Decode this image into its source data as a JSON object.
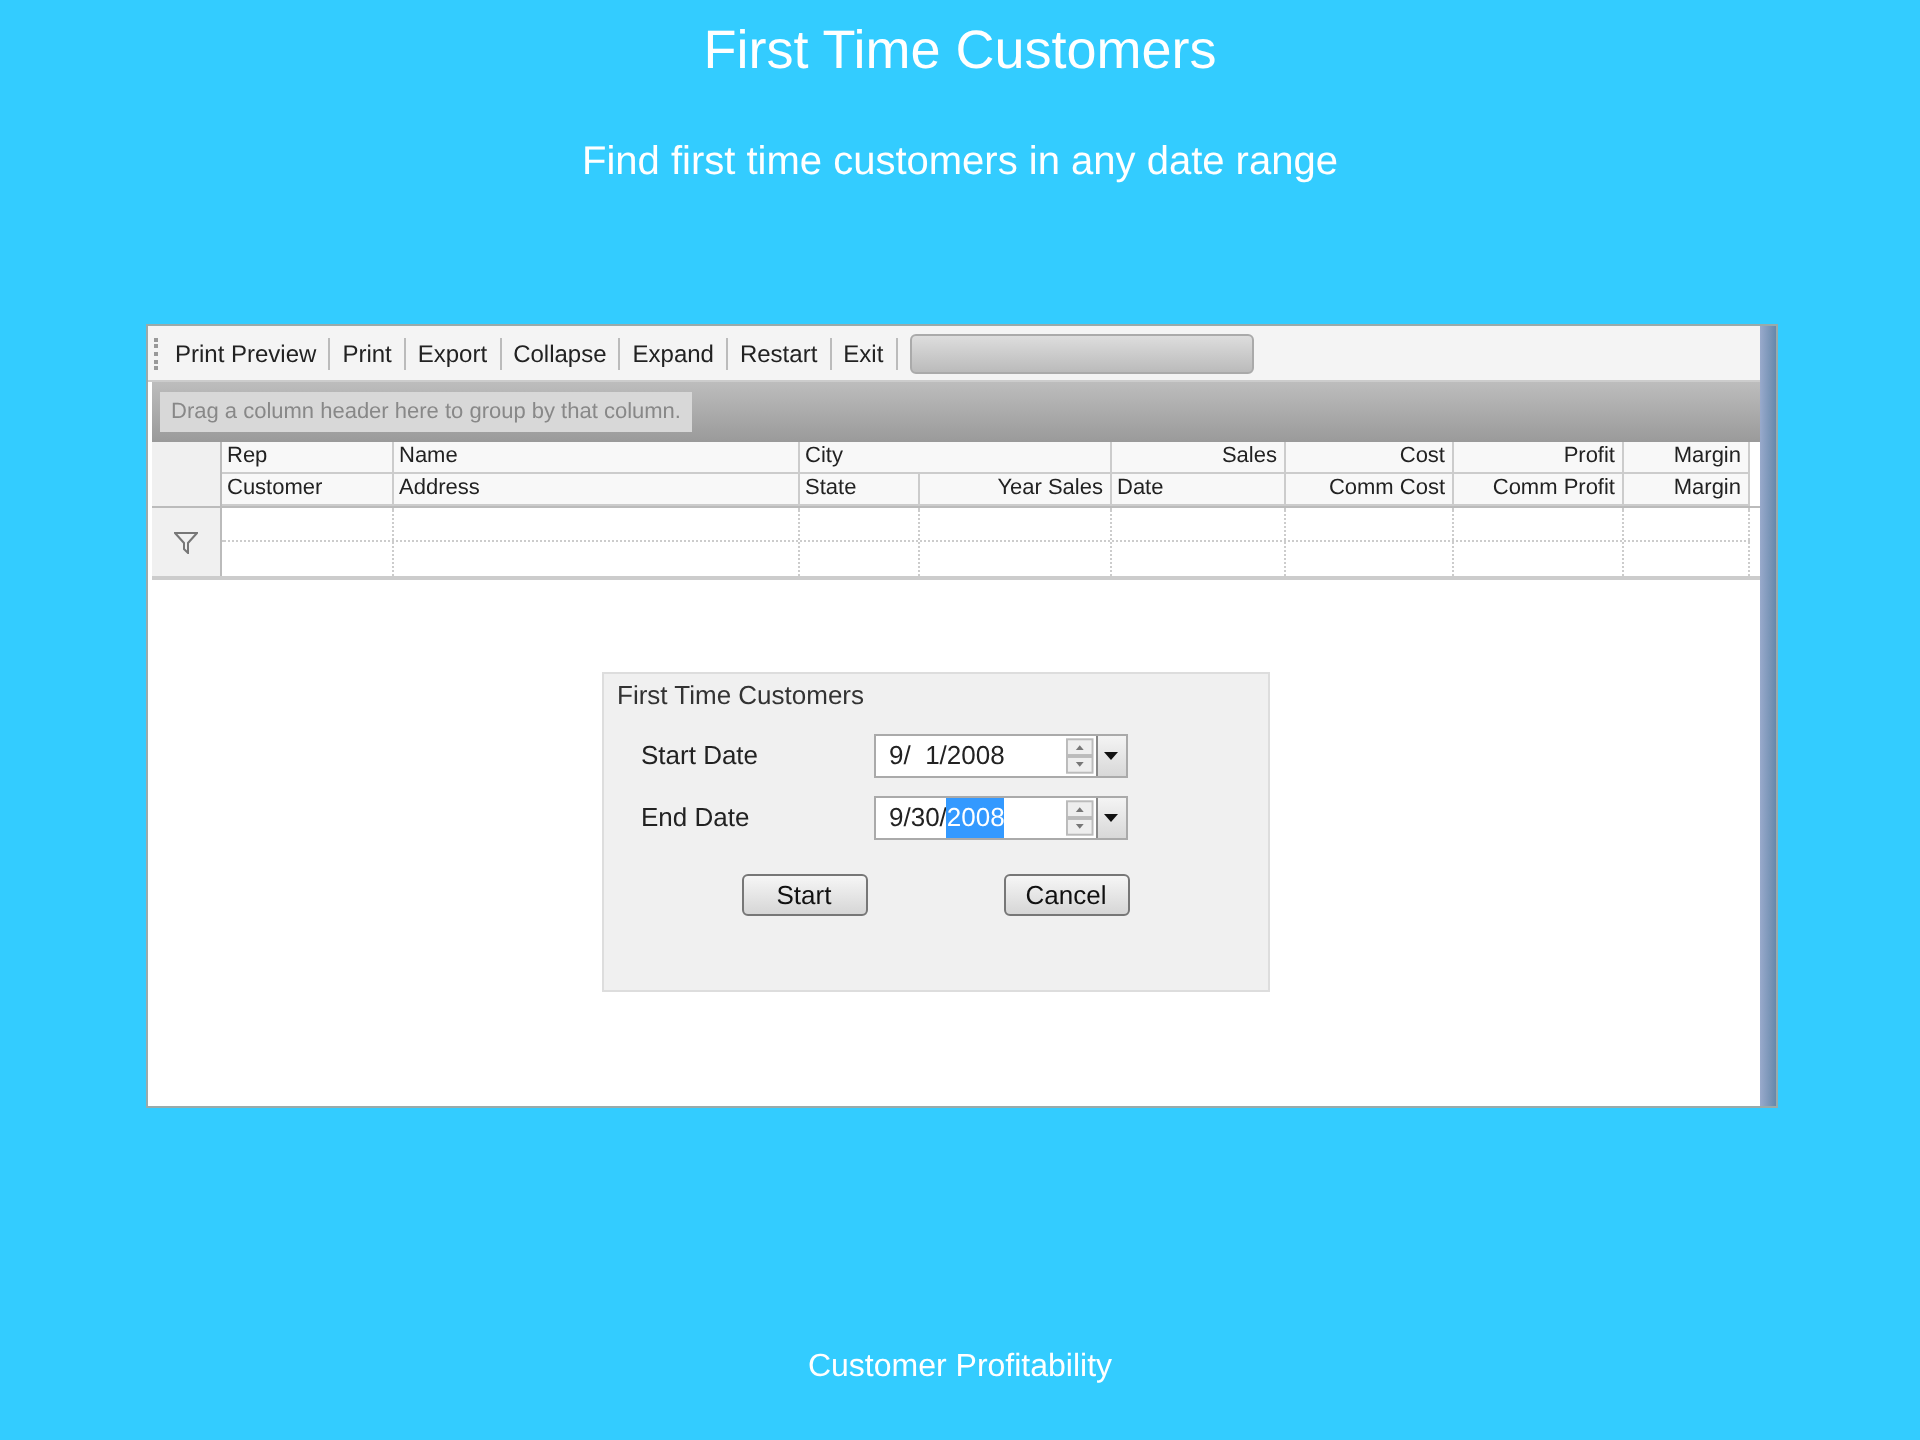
{
  "slide": {
    "title": "First Time Customers",
    "subtitle": "Find first time customers in any date range",
    "footer": "Customer Profitability"
  },
  "toolbar": {
    "buttons": [
      "Print Preview",
      "Print",
      "Export",
      "Collapse",
      "Expand",
      "Restart",
      "Exit"
    ],
    "field_disabled": true
  },
  "group_panel": {
    "hint": "Drag a column header here to group by that column."
  },
  "grid": {
    "header_rows": [
      [
        {
          "label": "Rep",
          "right_aligned": false
        },
        {
          "label": "Name",
          "right_aligned": false
        },
        {
          "label": "City",
          "right_aligned": false
        },
        {
          "label": "Sales",
          "right_aligned": true
        },
        {
          "label": "Cost",
          "right_aligned": true
        },
        {
          "label": "Profit",
          "right_aligned": true
        },
        {
          "label": "Margin",
          "right_aligned": true
        }
      ],
      [
        {
          "label": "Customer",
          "right_aligned": false
        },
        {
          "label": "Address",
          "right_aligned": false
        },
        {
          "label": "State",
          "right_aligned": false
        },
        {
          "label": "Year Sales",
          "right_aligned": true
        },
        {
          "label": "Date",
          "right_aligned": false
        },
        {
          "label": "Comm Cost",
          "right_aligned": true
        },
        {
          "label": "Comm Profit",
          "right_aligned": true
        },
        {
          "label": "Margin",
          "right_aligned": true
        }
      ]
    ]
  },
  "dialog": {
    "title": "First Time Customers",
    "fields": [
      {
        "label": "Start Date",
        "segments": [
          {
            "text": "9/  1/2008",
            "selected": false
          }
        ]
      },
      {
        "label": "End Date",
        "segments": [
          {
            "text": "9/30/",
            "selected": false
          },
          {
            "text": "2008",
            "selected": true
          }
        ]
      }
    ],
    "buttons": [
      "Start",
      "Cancel"
    ]
  }
}
